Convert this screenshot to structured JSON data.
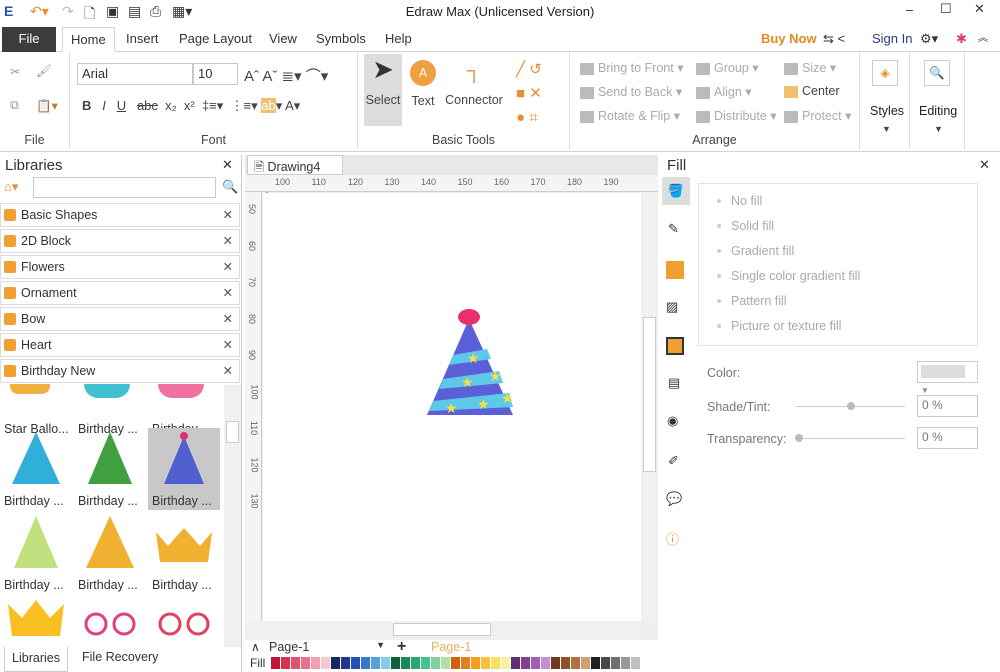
{
  "title": "Edraw Max (Unlicensed Version)",
  "tabs": [
    "File",
    "Home",
    "Insert",
    "Page Layout",
    "View",
    "Symbols",
    "Help"
  ],
  "topright": {
    "buy": "Buy Now",
    "sign": "Sign In"
  },
  "ribbon": {
    "font": "Arial",
    "size": "10",
    "groups": {
      "file": "File",
      "font": "Font",
      "basic": "Basic Tools",
      "arrange": "Arrange"
    },
    "select": "Select",
    "text": "Text",
    "connector": "Connector",
    "arrange": [
      "Bring to Front",
      "Send to Back",
      "Rotate & Flip",
      "Group",
      "Align",
      "Distribute",
      "Size",
      "Center",
      "Protect"
    ],
    "styles": "Styles",
    "editing": "Editing"
  },
  "libraries": {
    "title": "Libraries",
    "items": [
      "Basic Shapes",
      "2D Block",
      "Flowers",
      "Ornament",
      "Bow",
      "Heart",
      "Birthday New"
    ],
    "shapes": [
      "Star Ballo...",
      "Birthday ...",
      "Birthday ...",
      "Birthday ...",
      "Birthday ...",
      "Birthday ...",
      "Birthday ...",
      "Birthday ...",
      "Birthday ..."
    ],
    "bottom_tabs": [
      "Libraries",
      "File Recovery"
    ]
  },
  "document": {
    "tab": "Drawing4",
    "ruler_x": [
      "100",
      "110",
      "120",
      "130",
      "140",
      "150",
      "160",
      "170",
      "180",
      "190"
    ],
    "ruler_y": [
      "50",
      "60",
      "70",
      "80",
      "90",
      "100",
      "110",
      "120",
      "130"
    ]
  },
  "pages": {
    "current": "Page-1",
    "active": "Page-1",
    "fill_label": "Fill"
  },
  "fill": {
    "title": "Fill",
    "options": [
      "No fill",
      "Solid fill",
      "Gradient fill",
      "Single color gradient fill",
      "Pattern fill",
      "Picture or texture fill"
    ],
    "color_label": "Color:",
    "shade_label": "Shade/Tint:",
    "shade_value": "0 %",
    "trans_label": "Transparency:",
    "trans_value": "0 %"
  },
  "palette": [
    "#c0143c",
    "#d83050",
    "#e05070",
    "#e87090",
    "#f0a0b0",
    "#f8c8d0",
    "#182860",
    "#203890",
    "#2850b0",
    "#3878c8",
    "#58a0d8",
    "#88c8e8",
    "#106040",
    "#188858",
    "#28a870",
    "#48c090",
    "#80d0a0",
    "#b0e0a0",
    "#d06010",
    "#e08020",
    "#f0a020",
    "#f8c040",
    "#f8e060",
    "#f8f0a0",
    "#603070",
    "#804090",
    "#a060b0",
    "#c090d0",
    "#703818",
    "#905028",
    "#b07040",
    "#d0a070",
    "#202020",
    "#484848",
    "#707070",
    "#989898",
    "#c0c0c0"
  ]
}
